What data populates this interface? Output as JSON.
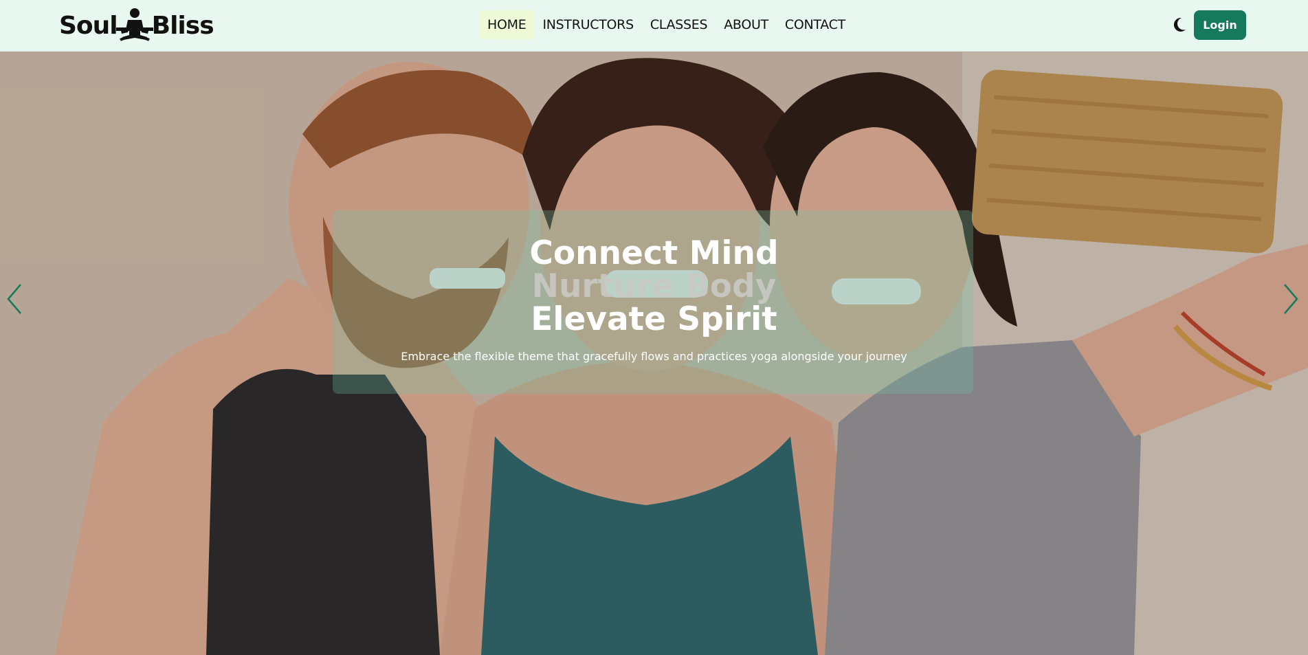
{
  "brand": {
    "name_left": "Soul",
    "name_right": "Bliss",
    "logo_icon": "meditation-figure-icon"
  },
  "nav": {
    "items": [
      {
        "label": "HOME",
        "active": true
      },
      {
        "label": "INSTRUCTORS",
        "active": false
      },
      {
        "label": "CLASSES",
        "active": false
      },
      {
        "label": "ABOUT",
        "active": false
      },
      {
        "label": "CONTACT",
        "active": false
      }
    ],
    "theme_toggle_icon": "moon-icon",
    "login_label": "Login"
  },
  "hero": {
    "headline": [
      "Connect Mind",
      "Nurture Body",
      "Elevate Spirit"
    ],
    "subtitle": "Embrace the flexible theme that gracefully flows and practices yoga alongside your journey",
    "prev_icon": "chevron-left-icon",
    "next_icon": "chevron-right-icon"
  },
  "colors": {
    "navbar_bg": "#e8f7ef",
    "accent": "#147a5b",
    "active_nav_bg": "#eefbd6",
    "arrow": "#147a5b"
  }
}
